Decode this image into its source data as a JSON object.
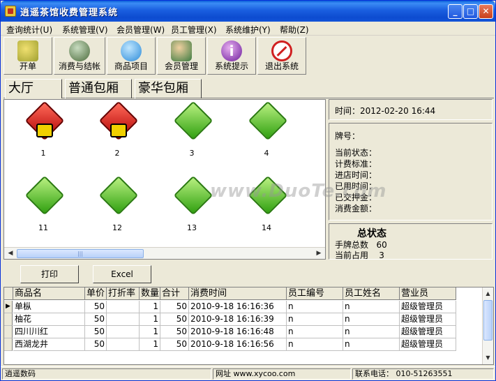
{
  "window": {
    "title": "逍遥茶馆收费管理系统",
    "controls": {
      "minimize": "_",
      "maximize": "□",
      "close": "✕"
    }
  },
  "menu": [
    "查询统计(U)",
    "系统管理(V)",
    "会员管理(W)",
    "员工管理(X)",
    "系统维护(Y)",
    "帮助(Z)"
  ],
  "toolbar": [
    {
      "label": "开单",
      "icon": "pen-icon"
    },
    {
      "label": "消费与结帐",
      "icon": "money-bag-icon"
    },
    {
      "label": "商品项目",
      "icon": "apple-icon"
    },
    {
      "label": "会员管理",
      "icon": "users-icon"
    },
    {
      "label": "系统提示",
      "icon": "info-icon"
    },
    {
      "label": "退出系统",
      "icon": "no-entry-icon"
    }
  ],
  "tabs": [
    "大厅",
    "普通包厢",
    "豪华包厢"
  ],
  "rooms": [
    {
      "number": "1",
      "status": "occupied"
    },
    {
      "number": "2",
      "status": "occupied"
    },
    {
      "number": "3",
      "status": "free"
    },
    {
      "number": "4",
      "status": "free"
    },
    {
      "number": "11",
      "status": "free"
    },
    {
      "number": "12",
      "status": "free"
    },
    {
      "number": "13",
      "status": "free"
    },
    {
      "number": "14",
      "status": "free"
    }
  ],
  "info": {
    "time_label": "时间：",
    "time_value": "2012-02-20 16:44",
    "tag_label": "牌号：",
    "current_status_label": "当前状态：",
    "billing_label": "计费标准：",
    "enter_time_label": "进店时间：",
    "used_time_label": "已用时间：",
    "deposit_label": "已交押金：",
    "amount_label": "消费金额："
  },
  "summary": {
    "title": "总状态",
    "total_label": "手牌总数",
    "total_value": "60",
    "occupied_label": "当前占用",
    "occupied_value": "3"
  },
  "buttons": {
    "print": "打印",
    "excel": "Excel"
  },
  "grid": {
    "columns": [
      "商品名",
      "单价",
      "打折率",
      "数量",
      "合计",
      "消费时间",
      "员工编号",
      "员工姓名",
      "营业员"
    ],
    "rows": [
      [
        "单枞",
        "50",
        "",
        "1",
        "50",
        "2010-9-18 16:16:36",
        "n",
        "n",
        "超级管理员"
      ],
      [
        "柚花",
        "50",
        "",
        "1",
        "50",
        "2010-9-18 16:16:39",
        "n",
        "n",
        "超级管理员"
      ],
      [
        "四川川红",
        "50",
        "",
        "1",
        "50",
        "2010-9-18 16:16:48",
        "n",
        "n",
        "超级管理员"
      ],
      [
        "西湖龙井",
        "50",
        "",
        "1",
        "50",
        "2010-9-18 16:16:56",
        "n",
        "n",
        "超级管理员"
      ]
    ]
  },
  "statusbar": {
    "name": "逍遥数码",
    "site_label": "网址",
    "site": "www.xycoo.com",
    "phone_label": "联系电话：",
    "phone": "010-51263551"
  },
  "watermark": "www.DuoTe.com"
}
